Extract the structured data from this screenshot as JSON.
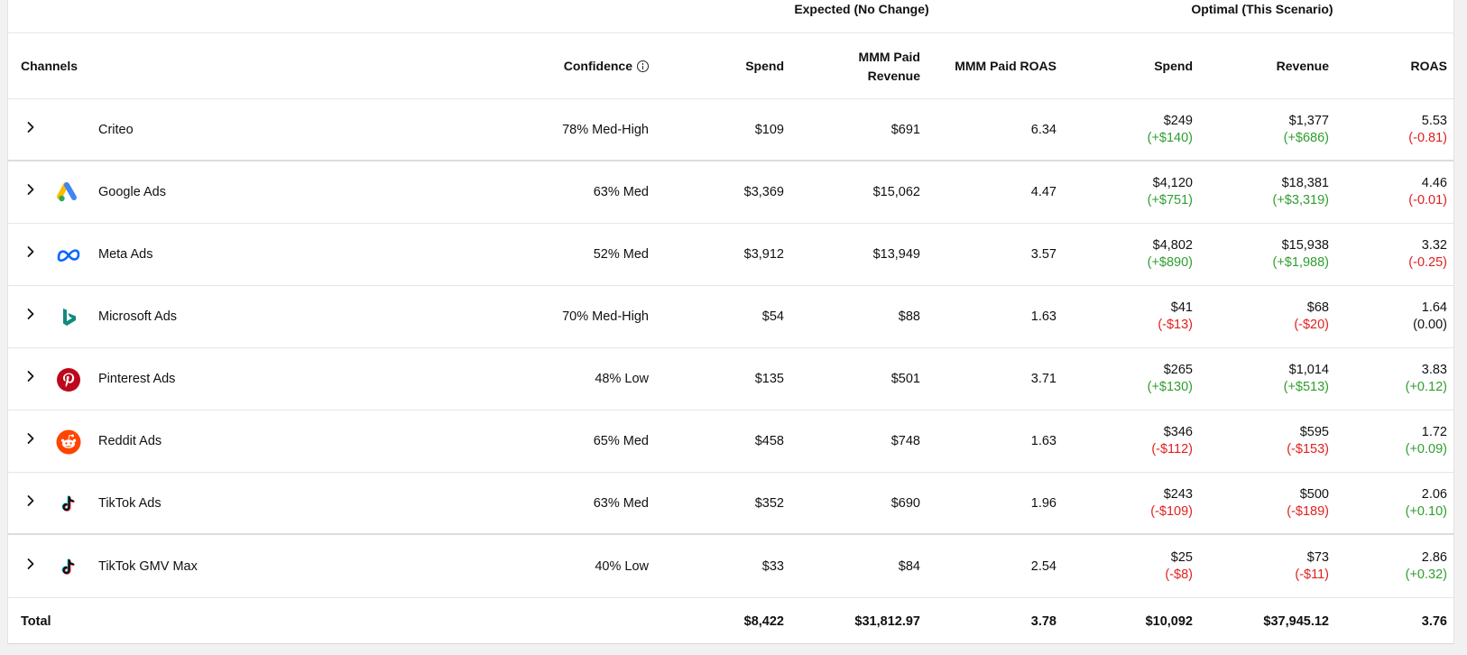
{
  "group_headers": {
    "expected": "Expected (No Change)",
    "optimal": "Optimal (This Scenario)"
  },
  "columns": {
    "channels": "Channels",
    "confidence": "Confidence",
    "spend": "Spend",
    "mmm_paid_revenue": "MMM Paid Revenue",
    "mmm_paid_roas": "MMM Paid ROAS",
    "opt_spend": "Spend",
    "opt_revenue": "Revenue",
    "opt_roas": "ROAS"
  },
  "rows": [
    {
      "channel": "Criteo",
      "icon": "criteo-icon",
      "confidence": "78% Med-High",
      "spend": "$109",
      "revenue": "$691",
      "roas": "6.34",
      "opt_spend": "$249",
      "opt_spend_delta": "(+$140)",
      "opt_spend_tone": "pos",
      "opt_revenue": "$1,377",
      "opt_revenue_delta": "(+$686)",
      "opt_revenue_tone": "pos",
      "opt_roas": "5.53",
      "opt_roas_delta": "(-0.81)",
      "opt_roas_tone": "neg"
    },
    {
      "channel": "Google Ads",
      "icon": "google-ads-icon",
      "confidence": "63% Med",
      "spend": "$3,369",
      "revenue": "$15,062",
      "roas": "4.47",
      "opt_spend": "$4,120",
      "opt_spend_delta": "(+$751)",
      "opt_spend_tone": "pos",
      "opt_revenue": "$18,381",
      "opt_revenue_delta": "(+$3,319)",
      "opt_revenue_tone": "pos",
      "opt_roas": "4.46",
      "opt_roas_delta": "(-0.01)",
      "opt_roas_tone": "neg"
    },
    {
      "channel": "Meta Ads",
      "icon": "meta-icon",
      "confidence": "52% Med",
      "spend": "$3,912",
      "revenue": "$13,949",
      "roas": "3.57",
      "opt_spend": "$4,802",
      "opt_spend_delta": "(+$890)",
      "opt_spend_tone": "pos",
      "opt_revenue": "$15,938",
      "opt_revenue_delta": "(+$1,988)",
      "opt_revenue_tone": "pos",
      "opt_roas": "3.32",
      "opt_roas_delta": "(-0.25)",
      "opt_roas_tone": "neg"
    },
    {
      "channel": "Microsoft Ads",
      "icon": "bing-icon",
      "confidence": "70% Med-High",
      "spend": "$54",
      "revenue": "$88",
      "roas": "1.63",
      "opt_spend": "$41",
      "opt_spend_delta": "(-$13)",
      "opt_spend_tone": "neg",
      "opt_revenue": "$68",
      "opt_revenue_delta": "(-$20)",
      "opt_revenue_tone": "neg",
      "opt_roas": "1.64",
      "opt_roas_delta": "(0.00)",
      "opt_roas_tone": "neu"
    },
    {
      "channel": "Pinterest Ads",
      "icon": "pinterest-icon",
      "confidence": "48% Low",
      "spend": "$135",
      "revenue": "$501",
      "roas": "3.71",
      "opt_spend": "$265",
      "opt_spend_delta": "(+$130)",
      "opt_spend_tone": "pos",
      "opt_revenue": "$1,014",
      "opt_revenue_delta": "(+$513)",
      "opt_revenue_tone": "pos",
      "opt_roas": "3.83",
      "opt_roas_delta": "(+0.12)",
      "opt_roas_tone": "pos"
    },
    {
      "channel": "Reddit Ads",
      "icon": "reddit-icon",
      "confidence": "65% Med",
      "spend": "$458",
      "revenue": "$748",
      "roas": "1.63",
      "opt_spend": "$346",
      "opt_spend_delta": "(-$112)",
      "opt_spend_tone": "neg",
      "opt_revenue": "$595",
      "opt_revenue_delta": "(-$153)",
      "opt_revenue_tone": "neg",
      "opt_roas": "1.72",
      "opt_roas_delta": "(+0.09)",
      "opt_roas_tone": "pos"
    },
    {
      "channel": "TikTok Ads",
      "icon": "tiktok-icon",
      "confidence": "63% Med",
      "spend": "$352",
      "revenue": "$690",
      "roas": "1.96",
      "opt_spend": "$243",
      "opt_spend_delta": "(-$109)",
      "opt_spend_tone": "neg",
      "opt_revenue": "$500",
      "opt_revenue_delta": "(-$189)",
      "opt_revenue_tone": "neg",
      "opt_roas": "2.06",
      "opt_roas_delta": "(+0.10)",
      "opt_roas_tone": "pos"
    },
    {
      "channel": "TikTok GMV Max",
      "icon": "tiktok-icon",
      "confidence": "40% Low",
      "spend": "$33",
      "revenue": "$84",
      "roas": "2.54",
      "opt_spend": "$25",
      "opt_spend_delta": "(-$8)",
      "opt_spend_tone": "neg",
      "opt_revenue": "$73",
      "opt_revenue_delta": "(-$11)",
      "opt_revenue_tone": "neg",
      "opt_roas": "2.86",
      "opt_roas_delta": "(+0.32)",
      "opt_roas_tone": "pos"
    }
  ],
  "total": {
    "label": "Total",
    "spend": "$8,422",
    "revenue": "$31,812.97",
    "roas": "3.78",
    "opt_spend": "$10,092",
    "opt_revenue": "$37,945.12",
    "opt_roas": "3.76"
  },
  "colors": {
    "positive": "#2f9e2f",
    "negative": "#e0201f"
  }
}
